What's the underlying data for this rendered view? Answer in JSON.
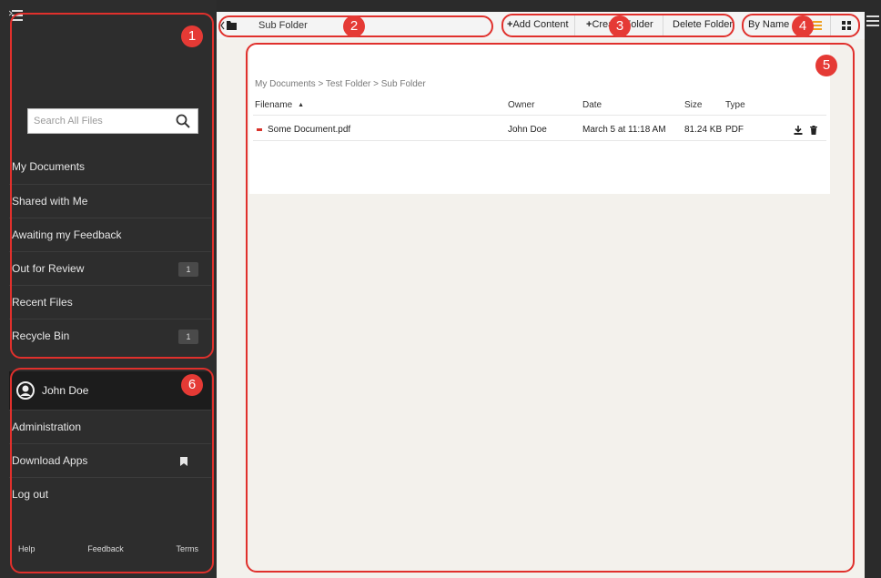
{
  "sidebar": {
    "search_placeholder": "Search All Files",
    "nav_items": [
      {
        "label": "My Documents",
        "badge": ""
      },
      {
        "label": "Shared with Me",
        "badge": ""
      },
      {
        "label": "Awaiting my Feedback",
        "badge": ""
      },
      {
        "label": "Out for Review",
        "badge": "1"
      },
      {
        "label": "Recent Files",
        "badge": ""
      },
      {
        "label": "Recycle Bin",
        "badge": "1"
      }
    ],
    "user": {
      "name": "John Doe",
      "items": [
        "Administration",
        "Download Apps",
        "Log out"
      ]
    },
    "footer": {
      "help": "Help",
      "feedback": "Feedback",
      "terms": "Terms"
    }
  },
  "toolbar": {
    "folder_name": "Sub Folder",
    "add_content": "Add Content",
    "create_folder": "Create Folder",
    "delete_folder": "Delete Folder",
    "sort_by": "By Name"
  },
  "main": {
    "breadcrumb": "My Documents > Test Folder > Sub Folder",
    "columns": {
      "filename": "Filename",
      "owner": "Owner",
      "date": "Date",
      "size": "Size",
      "type": "Type"
    },
    "files": [
      {
        "name": "Some Document.pdf",
        "owner": "John Doe",
        "date": "March 5 at 11:18 AM",
        "size": "81.24 KB",
        "type": "PDF"
      }
    ]
  },
  "annotations": [
    "1",
    "2",
    "3",
    "4",
    "5",
    "6"
  ],
  "colors": {
    "annotation": "#e0302c",
    "sidebar_bg": "#2d2d2d",
    "content_bg": "#f3f1ec",
    "pdf_icon": "#d9332b",
    "list_view_icon": "#f0a020"
  }
}
